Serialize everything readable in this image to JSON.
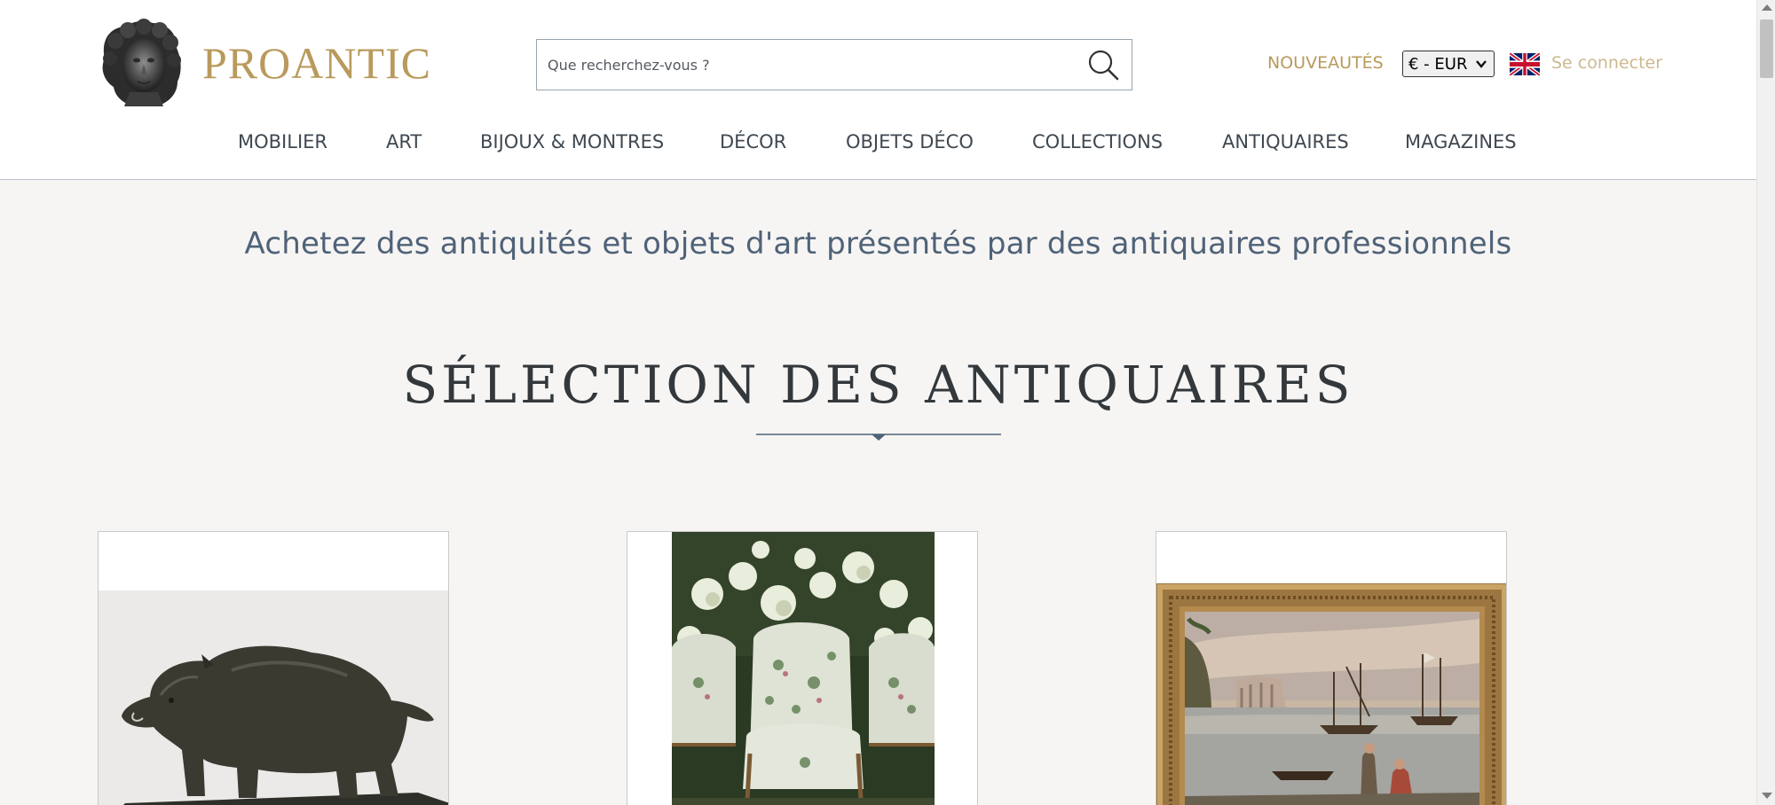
{
  "header": {
    "logo_text": "PROANTIC",
    "search": {
      "placeholder": "Que recherchez-vous ?",
      "value": ""
    },
    "nouveautes_label": "NOUVEAUTÉS",
    "currency": "€ - EUR",
    "login_label": "Se connecter"
  },
  "nav": {
    "items": [
      "MOBILIER",
      "ART",
      "BIJOUX & MONTRES",
      "DÉCOR",
      "OBJETS DÉCO",
      "COLLECTIONS",
      "ANTIQUAIRES",
      "MAGAZINES"
    ]
  },
  "main": {
    "tagline": "Achetez des antiquités et objets d'art présentés par des antiquaires professionnels",
    "section_title": "SÉLECTION DES ANTIQUAIRES"
  },
  "icons": {
    "search": "search-icon",
    "flag": "uk-flag-icon",
    "logo": "logo-bust-icon",
    "divider": "divider-diamond-icon"
  },
  "colors": {
    "gold": "#b89a5c",
    "nav_text": "#3f4850",
    "tagline": "#4f6278",
    "title": "#33383c",
    "background": "#f6f5f3"
  }
}
